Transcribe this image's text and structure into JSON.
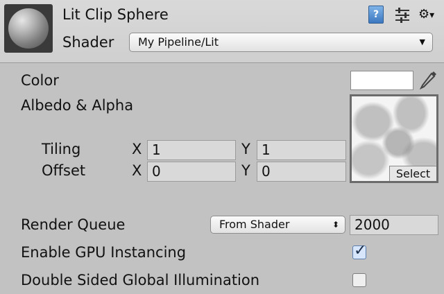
{
  "header": {
    "title": "Lit Clip Sphere",
    "shader_label": "Shader",
    "shader_value": "My Pipeline/Lit",
    "icons": [
      "help-book-icon",
      "preset-sliders-icon",
      "settings-gear-icon"
    ]
  },
  "properties": {
    "color_label": "Color",
    "color_value": "#ffffff",
    "albedo_label": "Albedo & Alpha",
    "tiling": {
      "label": "Tiling",
      "x_label": "X",
      "x": "1",
      "y_label": "Y",
      "y": "1"
    },
    "offset": {
      "label": "Offset",
      "x_label": "X",
      "x": "0",
      "y_label": "Y",
      "y": "0"
    },
    "select_label": "Select",
    "render_queue_label": "Render Queue",
    "render_queue_mode": "From Shader",
    "render_queue_value": "2000",
    "gpu_instancing_label": "Enable GPU Instancing",
    "gpu_instancing_checked": true,
    "double_sided_gi_label": "Double Sided Global Illumination",
    "double_sided_gi_checked": false
  },
  "colors": {
    "panel_bg": "#c2c2c2",
    "header_bg": "#d4d4d4",
    "field_bg": "#d9d9d9"
  }
}
